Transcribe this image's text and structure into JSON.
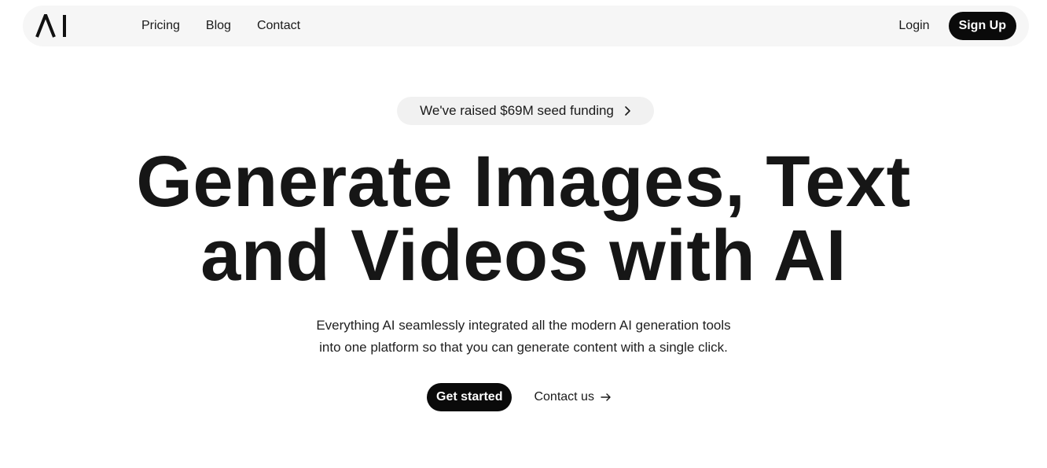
{
  "navbar": {
    "logo_text": "AI",
    "links": [
      {
        "label": "Pricing"
      },
      {
        "label": "Blog"
      },
      {
        "label": "Contact"
      }
    ],
    "login_label": "Login",
    "signup_label": "Sign Up"
  },
  "hero": {
    "announcement": "We've raised $69M seed funding",
    "announcement_icon": "chevron-right-icon",
    "title_line_1": "Generate Images, Text",
    "title_line_2": "and Videos with AI",
    "subtitle_line_1": "Everything AI seamlessly integrated all the modern AI generation tools",
    "subtitle_line_2": "into one platform so that you can generate content with a single click.",
    "primary_cta": "Get started",
    "secondary_cta": "Contact us",
    "secondary_cta_icon": "arrow-right-icon"
  },
  "colors": {
    "background": "#ffffff",
    "navbar_bg": "#f6f6f6",
    "pill_bg": "#f1f1f1",
    "button_bg": "#0a0a0a",
    "button_text": "#ffffff",
    "text": "#161616"
  }
}
